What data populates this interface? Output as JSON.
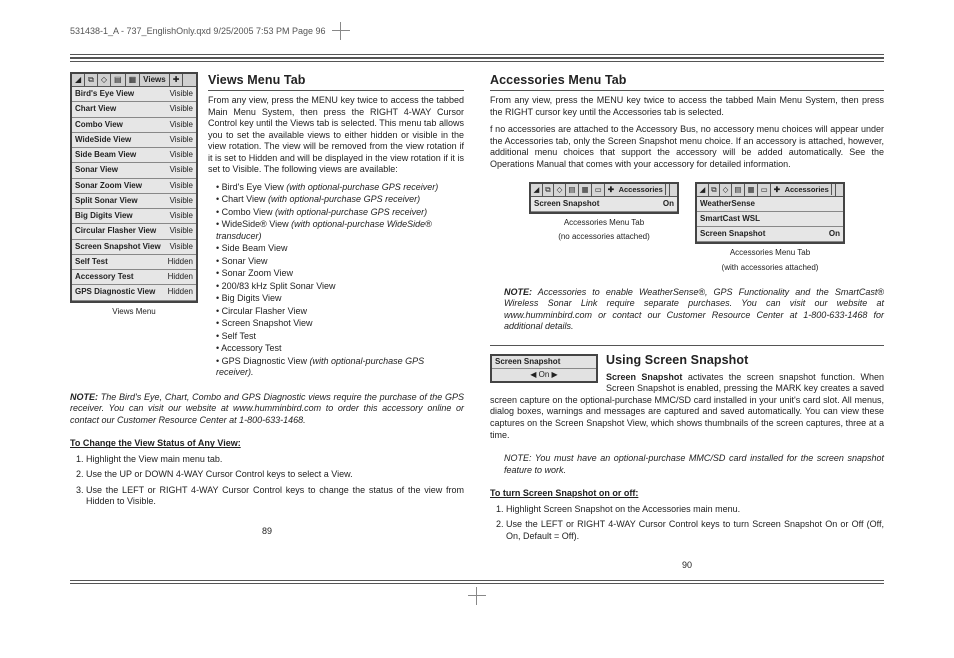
{
  "header": "531438-1_A - 737_EnglishOnly.qxd  9/25/2005  7:53 PM  Page 96",
  "left": {
    "h_views": "Views Menu Tab",
    "views_p": "From any view, press the MENU key twice to access the tabbed Main Menu System, then press the RIGHT 4-WAY Cursor Control key until the Views tab is selected. This menu tab allows you to set the available views to either hidden or visible in the view rotation.  The view will be removed from the view rotation if it is set to Hidden and will be displayed in the view rotation if it is set to Visible. The following views are available:",
    "views_list": [
      {
        "t": "Bird's Eye View",
        "sub": "(with optional-purchase GPS receiver)"
      },
      {
        "t": "Chart View",
        "sub": "(with optional-purchase GPS receiver)"
      },
      {
        "t": "Combo View",
        "sub": "(with optional-purchase GPS receiver)"
      },
      {
        "t": "WideSide® View",
        "sub": "(with optional-purchase WideSide® transducer)"
      },
      {
        "t": "Side Beam View",
        "sub": ""
      },
      {
        "t": "Sonar View",
        "sub": ""
      },
      {
        "t": "Sonar Zoom View",
        "sub": ""
      },
      {
        "t": "200/83 kHz Split Sonar View",
        "sub": ""
      },
      {
        "t": "Big Digits View",
        "sub": ""
      },
      {
        "t": "Circular Flasher View",
        "sub": ""
      },
      {
        "t": "Screen Snapshot View",
        "sub": ""
      },
      {
        "t": "Self Test",
        "sub": ""
      },
      {
        "t": "Accessory Test",
        "sub": ""
      },
      {
        "t": "GPS Diagnostic View",
        "sub": "(with optional-purchase GPS receiver)."
      }
    ],
    "views_ss_rows": [
      {
        "l": "Bird's Eye View",
        "v": "Visible"
      },
      {
        "l": "Chart View",
        "v": "Visible"
      },
      {
        "l": "Combo View",
        "v": "Visible"
      },
      {
        "l": "WideSide View",
        "v": "Visible"
      },
      {
        "l": "Side Beam View",
        "v": "Visible"
      },
      {
        "l": "Sonar View",
        "v": "Visible"
      },
      {
        "l": "Sonar Zoom View",
        "v": "Visible"
      },
      {
        "l": "Split Sonar View",
        "v": "Visible"
      },
      {
        "l": "Big Digits View",
        "v": "Visible"
      },
      {
        "l": "Circular Flasher View",
        "v": "Visible"
      },
      {
        "l": "Screen Snapshot View",
        "v": "Visible"
      },
      {
        "l": "Self Test",
        "v": "Hidden"
      },
      {
        "l": "Accessory Test",
        "v": "Hidden"
      },
      {
        "l": "GPS Diagnostic View",
        "v": "Hidden"
      }
    ],
    "views_tab_label": "Views",
    "views_ss_caption": "Views Menu",
    "note1_label": "NOTE:",
    "note1": " The Bird's Eye, Chart, Combo and GPS Diagnostic views require the purchase of the GPS receiver. You can visit our website at www.humminbird.com to order this accessory online or contact our Customer Resource Center at 1-800-633-1468.",
    "change_h": "To Change the View Status of Any View:",
    "change_steps": [
      "Highlight the View main menu tab.",
      "Use the UP or DOWN 4-WAY Cursor Control keys to select a View.",
      "Use the LEFT or RIGHT 4-WAY Cursor Control keys to change the status of the view from Hidden to Visible."
    ],
    "page": "89"
  },
  "right": {
    "h_acc": "Accessories Menu Tab",
    "acc_p1": "From any view, press the MENU key twice to access the tabbed Main Menu System, then press the RIGHT cursor key until the Accessories tab is selected.",
    "acc_p2": "f no accessories are attached to the Accessory Bus, no accessory menu choices will appear under the Accessories tab, only the Screen Snapshot menu choice. If an accessory is attached, however, additional menu choices that support the accessory will be added automatically.  See the Operations Manual that comes with your accessory for detailed information.",
    "acc_tab_label": "Accessories",
    "acc_box1_rows": [
      {
        "l": "Screen Snapshot",
        "v": "On"
      }
    ],
    "acc_box1_cap1": "Accessories Menu Tab",
    "acc_box1_cap2": "(no accessories attached)",
    "acc_box2_rows": [
      {
        "l": "WeatherSense",
        "v": ""
      },
      {
        "l": "SmartCast WSL",
        "v": ""
      },
      {
        "l": "Screen Snapshot",
        "v": "On"
      }
    ],
    "acc_box2_cap1": "Accessories Menu Tab",
    "acc_box2_cap2": "(with accessories attached)",
    "note2_label": "NOTE:",
    "note2": " Accessories to enable WeatherSense®, GPS Functionality and the SmartCast® Wireless Sonar Link require separate purchases.  You can visit our website at www.humminbird.com or contact our Customer Resource Center at 1-800-633-1468 for additional details.",
    "h_snap": "Using Screen Snapshot",
    "snap_box_title": "Screen Snapshot",
    "snap_box_val": "On",
    "snap_p": "Screen Snapshot activates the screen snapshot function. When Screen Snapshot is enabled, pressing the MARK key creates a saved screen capture on the optional-purchase MMC/SD card installed in your unit's card slot. All menus, dialog boxes, warnings and messages are captured and saved automatically. You can view these captures on the Screen Snapshot View, which shows thumbnails of the screen captures, three at a time.",
    "note3": "NOTE: You must have an optional-purchase MMC/SD card installed for the screen snapshot feature to work.",
    "turn_h": "To turn Screen Snapshot on or off:",
    "turn_steps": [
      "Highlight Screen Snapshot on the Accessories main menu.",
      "Use the LEFT or RIGHT 4-WAY Cursor Control keys to turn Screen Snapshot On or Off (Off, On, Default = Off)."
    ],
    "page": "90"
  }
}
